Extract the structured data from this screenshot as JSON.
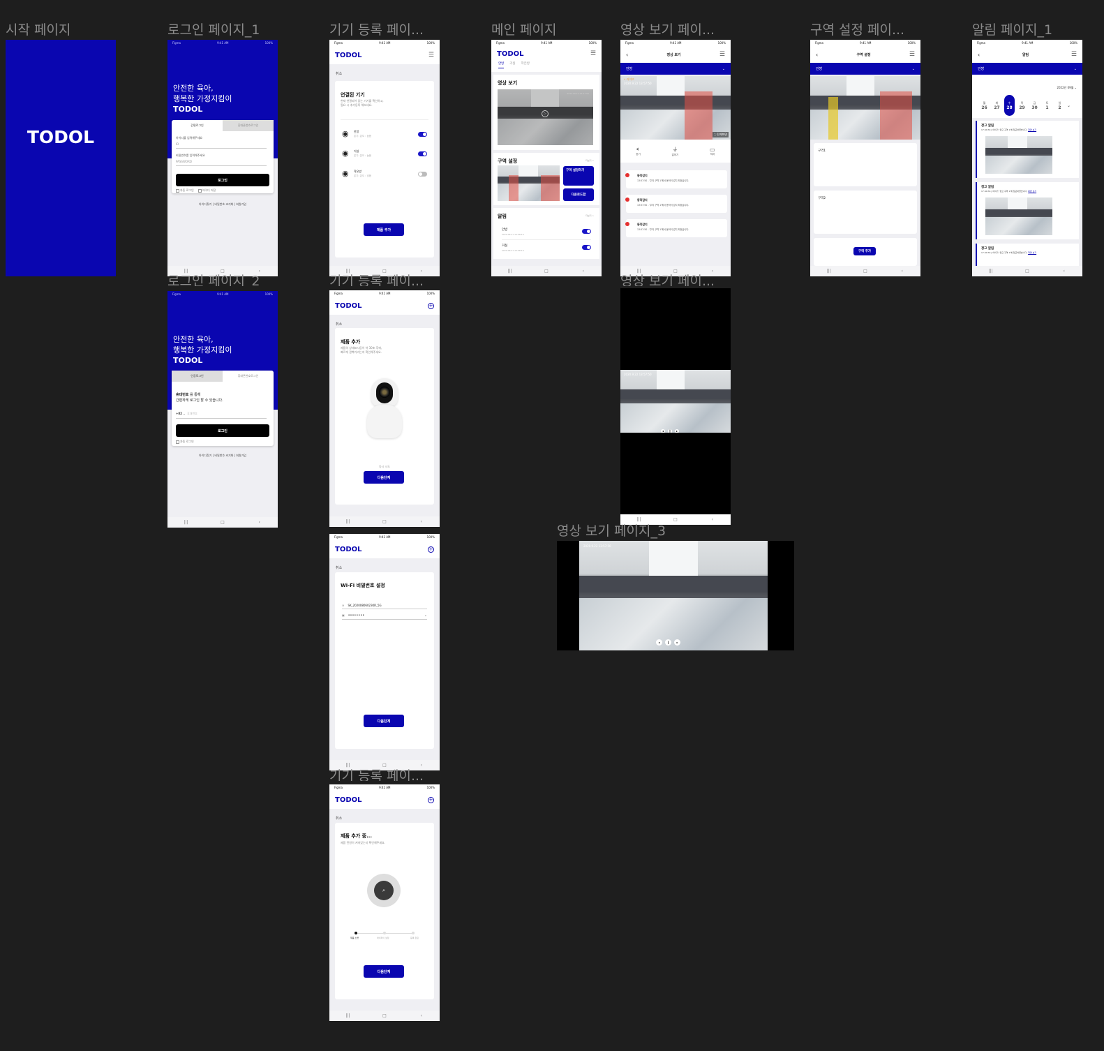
{
  "frames": {
    "start": {
      "title": "시작 페이지",
      "logo": "TODOL"
    },
    "login1": {
      "title": "로그인 페이지_1",
      "hero": [
        "안전한 육아,",
        "행복한 가정지킴이",
        "TODOL"
      ],
      "tab_id": "간편로그인",
      "tab_phone": "휴대폰번호로그인",
      "id_label": "아이디를 입력해주세요",
      "id_placeholder": "ID",
      "pw_label": "비밀번호를 입력해주세요",
      "pw_placeholder": "PASSWORD",
      "login_button": "로그인",
      "auto_login": "자동 로그인",
      "save_id": "아이디 저장",
      "links": "아이디찾기 | 비밀번호 초기화 | 회원가입"
    },
    "login2": {
      "title": "로그인 페이지_2",
      "hero": [
        "안전한 육아,",
        "행복한 가정지킴이",
        "TODOL"
      ],
      "tab_id": "인증로그인",
      "tab_phone": "휴대폰번호로그인",
      "phone_bold": "휴대번호",
      "phone_msg1": " 를 통해",
      "phone_msg2": "간편하게 로그인 할 수 있습니다.",
      "country_code": "+82",
      "phone_placeholder": "휴대번호",
      "login_button": "로그인",
      "auto_login": "자동 로그인",
      "links": "아이디찾기 | 비밀번호 초기화 | 회원가입"
    },
    "device1": {
      "title": "기기 등록 페이...",
      "logo": "TODOL",
      "cancel": "취소",
      "heading": "연결된 기기",
      "desc1": "현재 연결되어 있는 기기를 확인하고,",
      "desc2": "필요 시 추가등록 해보세요.",
      "devices": [
        {
          "name": "안방",
          "sub": "온기: 온도 : 높음",
          "on": true
        },
        {
          "name": "거실",
          "sub": "온기: 온도 : 높음",
          "on": true
        },
        {
          "name": "작은방",
          "sub": "온기: 온도 : 낮음",
          "on": false
        }
      ],
      "add_button": "제품 추가"
    },
    "device2": {
      "title": "기기 등록 페이...",
      "logo": "TODOL",
      "cancel": "취소",
      "heading": "제품 추가",
      "desc1": "제품의 상태표시등이 약 30초 후에,",
      "desc2": "빠르게 깜빡거리는지 확인해주세요.",
      "retry": "다시 시도",
      "next_button": "다음단계"
    },
    "device3": {
      "title": "기기 등록 페이...",
      "logo": "TODOL",
      "cancel": "취소",
      "heading": "Wi-Fi 비밀번호 설정",
      "ssid": "SK_20200806023KR_5G",
      "password": "••••••••",
      "next_button": "다음단계"
    },
    "device4": {
      "title": "기기 등록 페이...",
      "logo": "TODOL",
      "cancel": "취소",
      "heading": "제품 추가 중...",
      "desc": "제품 전원이 켜져있는지 확인해주세요.",
      "steps": [
        "제품 소켓",
        "와이파이 설정",
        "등록 완료"
      ],
      "next_button": "다음단계"
    },
    "main": {
      "title": "메인 페이지",
      "logo": "TODOL",
      "tabs": [
        "안방",
        "거실",
        "작은방"
      ],
      "video_heading": "영상 보기",
      "video_ts": "2022.09.12 12:57:50",
      "zone_heading": "구역 설정",
      "more": "더보기 >",
      "zone_button": "구역 설정하기",
      "download_button": "다운로드함",
      "alarm_heading": "알림",
      "alarms": [
        {
          "name": "안방",
          "date": "2022.09.27 10:08:19",
          "on": true
        },
        {
          "name": "거실",
          "date": "2022.09.27 10:08:19",
          "on": true
        }
      ]
    },
    "video1": {
      "title": "영상 보기 페이...",
      "header": "영상 보기",
      "room": "안방",
      "live": "• 라이브",
      "ts": "2020.9.22 13:57:50",
      "fullscreen": "전체화면",
      "controls": [
        "듣기",
        "말하기",
        "녹화"
      ],
      "events": [
        {
          "title": "동작감지",
          "msg": "13:57:50 - '주의 구역 1'에서 동작이 감지 되었습니다."
        },
        {
          "title": "동작감지",
          "msg": "13:57:50 - '주의 구역 1'에서 동작이 감지 되었습니다."
        },
        {
          "title": "동작감지",
          "msg": "13:57:50 - '주의 구역 1'에서 동작이 감지 되었습니다."
        }
      ]
    },
    "video2": {
      "title": "영상 보기 페이...",
      "ts": "2020.9.22 13:57:50"
    },
    "video3": {
      "title": "영상 보기 페이지_3",
      "ts": "2020.9.22 13:57:50"
    },
    "zone": {
      "title": "구역 설정 페이...",
      "header": "구역 설정",
      "room": "안방",
      "zone1": "구역1",
      "zone2": "구역2",
      "add_button": "구역 추가"
    },
    "alarm": {
      "title": "알림  페이지_1",
      "header": "알림",
      "room": "안방",
      "month": "2022년 09월",
      "days": [
        {
          "w": "월",
          "d": "26"
        },
        {
          "w": "화",
          "d": "27"
        },
        {
          "w": "수",
          "d": "28"
        },
        {
          "w": "목",
          "d": "29"
        },
        {
          "w": "금",
          "d": "30"
        },
        {
          "w": "토",
          "d": "1"
        },
        {
          "w": "일",
          "d": "2"
        }
      ],
      "items": [
        {
          "title": "경고 알림",
          "msg": "17:40:34 | 아이가 '경고 구역 1'에 접근하였습니다.",
          "link": "화면 보기"
        },
        {
          "title": "경고 알림",
          "msg": "17:40:34 | 아이가 '경고 구역 1'에 접근하였습니다.",
          "link": "화면 보기"
        },
        {
          "title": "경고 알림",
          "msg": "17:40:34 | 아이가 '경고 구역 1'에 접근하였습니다.",
          "link": "화면 보기"
        }
      ]
    }
  },
  "status": {
    "carrier": "Figma",
    "time": "9:41 AM",
    "battery": "100%"
  },
  "colors": {
    "brand": "#0a06b0",
    "canvas": "#1e1e1e",
    "alert": "#e53030"
  }
}
